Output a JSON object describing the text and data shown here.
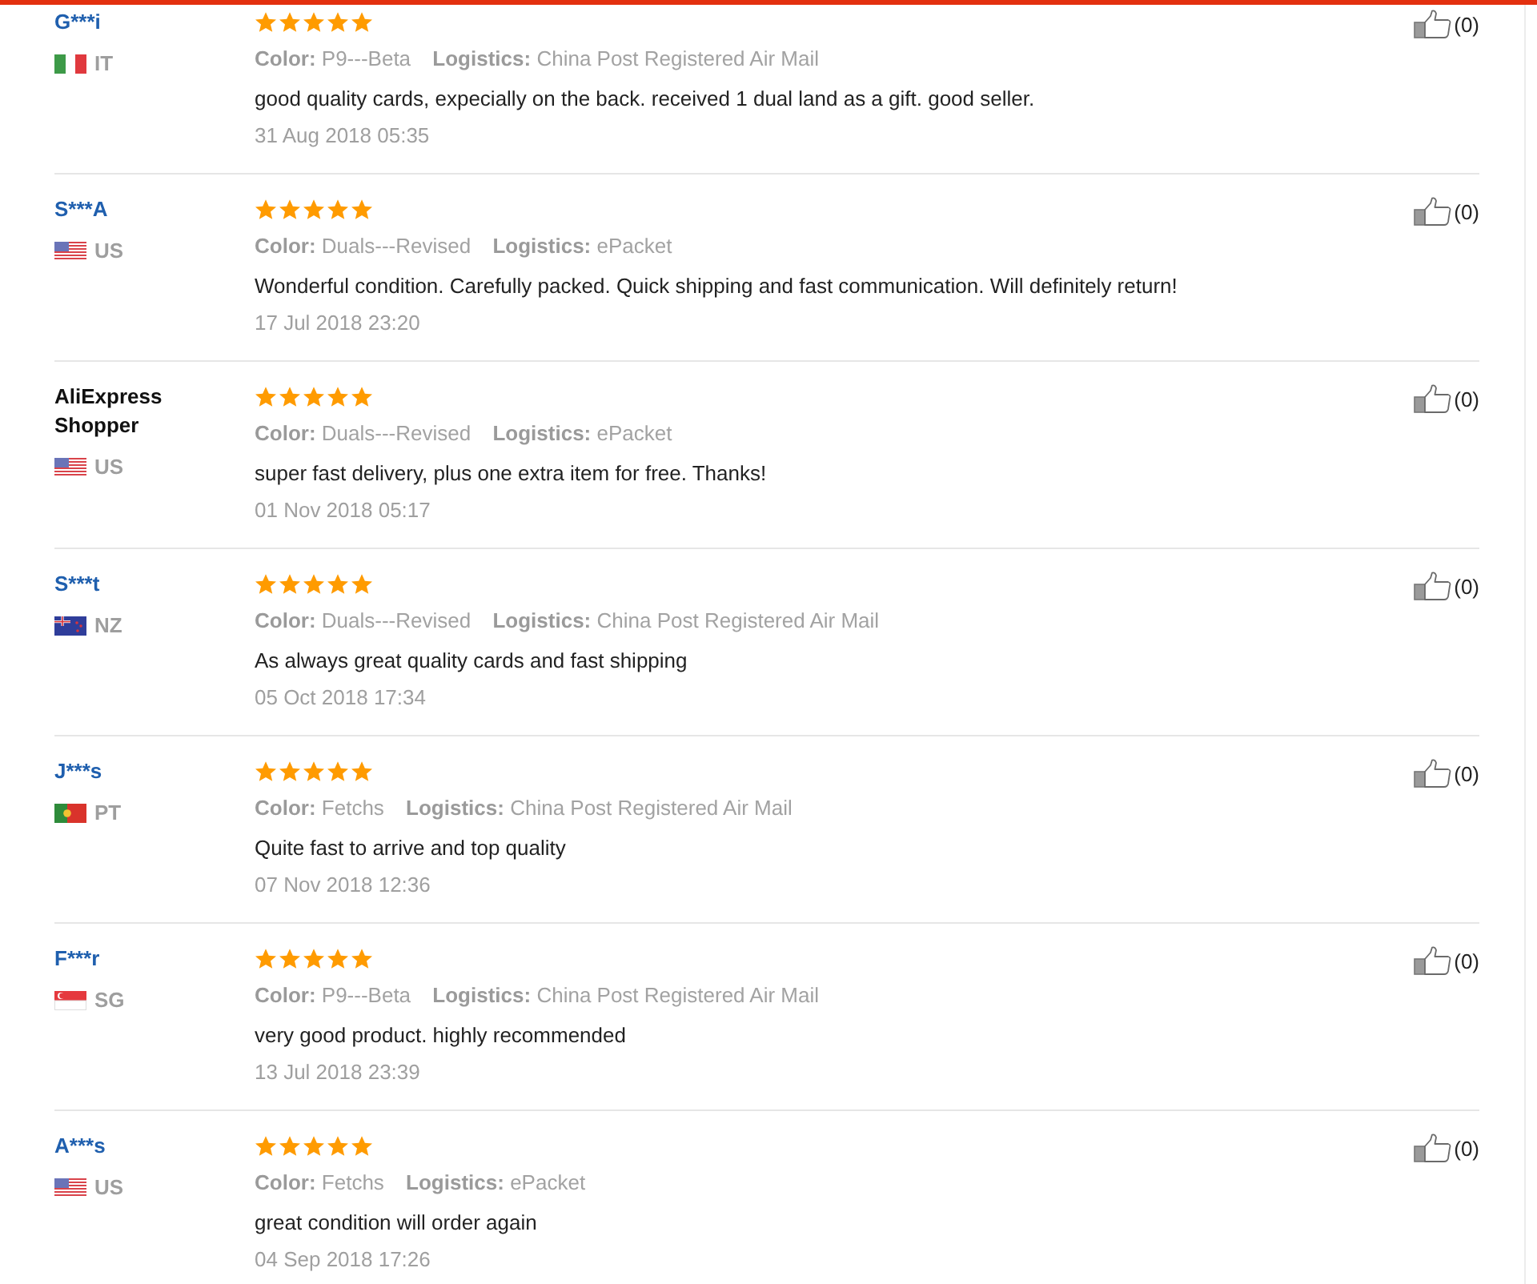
{
  "reviews": [
    {
      "reviewer": "G***i",
      "kind": "masked",
      "country": "IT",
      "flag": {
        "kind": "vertical-tricolor"
      },
      "stars": 5,
      "variant_label": "Color:",
      "variant": "P9---Beta",
      "logistics_label": "Logistics:",
      "logistics": "China Post Registered Air Mail",
      "text": "good quality cards, expecially on the back. received 1 dual land as a gift. good seller.",
      "date": "31 Aug 2018 05:35",
      "likes": "(0)"
    },
    {
      "reviewer": "S***A",
      "kind": "masked",
      "country": "US",
      "flag": {
        "kind": "stars-stripes"
      },
      "stars": 5,
      "variant_label": "Color:",
      "variant": "Duals---Revised",
      "logistics_label": "Logistics:",
      "logistics": "ePacket",
      "text": "Wonderful condition. Carefully packed. Quick shipping and fast communication. Will definitely return!",
      "date": "17 Jul 2018 23:20",
      "likes": "(0)"
    },
    {
      "reviewer": "AliExpress Shopper",
      "kind": "shopper",
      "country": "US",
      "flag": {
        "kind": "stars-stripes"
      },
      "stars": 5,
      "variant_label": "Color:",
      "variant": "Duals---Revised",
      "logistics_label": "Logistics:",
      "logistics": "ePacket",
      "text": "super fast delivery, plus one extra item for free. Thanks!",
      "date": "01 Nov 2018 05:17",
      "likes": "(0)"
    },
    {
      "reviewer": "S***t",
      "kind": "masked",
      "country": "NZ",
      "flag": {
        "kind": "ensign"
      },
      "stars": 5,
      "variant_label": "Color:",
      "variant": "Duals---Revised",
      "logistics_label": "Logistics:",
      "logistics": "China Post Registered Air Mail",
      "text": "As always great quality cards and fast shipping",
      "date": "05 Oct 2018 17:34",
      "likes": "(0)"
    },
    {
      "reviewer": "J***s",
      "kind": "masked",
      "country": "PT",
      "flag": {
        "kind": "bicolor-vertical"
      },
      "stars": 5,
      "variant_label": "Color:",
      "variant": "Fetchs",
      "logistics_label": "Logistics:",
      "logistics": "China Post Registered Air Mail",
      "text": "Quite fast to arrive and top quality",
      "date": "07 Nov 2018 12:36",
      "likes": "(0)"
    },
    {
      "reviewer": "F***r",
      "kind": "masked",
      "country": "SG",
      "flag": {
        "kind": "bicolor-horizontal"
      },
      "stars": 5,
      "variant_label": "Color:",
      "variant": "P9---Beta",
      "logistics_label": "Logistics:",
      "logistics": "China Post Registered Air Mail",
      "text": "very good product. highly recommended",
      "date": "13 Jul 2018 23:39",
      "likes": "(0)"
    },
    {
      "reviewer": "A***s",
      "kind": "masked",
      "country": "US",
      "flag": {
        "kind": "stars-stripes"
      },
      "stars": 5,
      "variant_label": "Color:",
      "variant": "Fetchs",
      "logistics_label": "Logistics:",
      "logistics": "ePacket",
      "text": "great condition will order again",
      "date": "04 Sep 2018 17:26",
      "likes": "(0)"
    }
  ]
}
